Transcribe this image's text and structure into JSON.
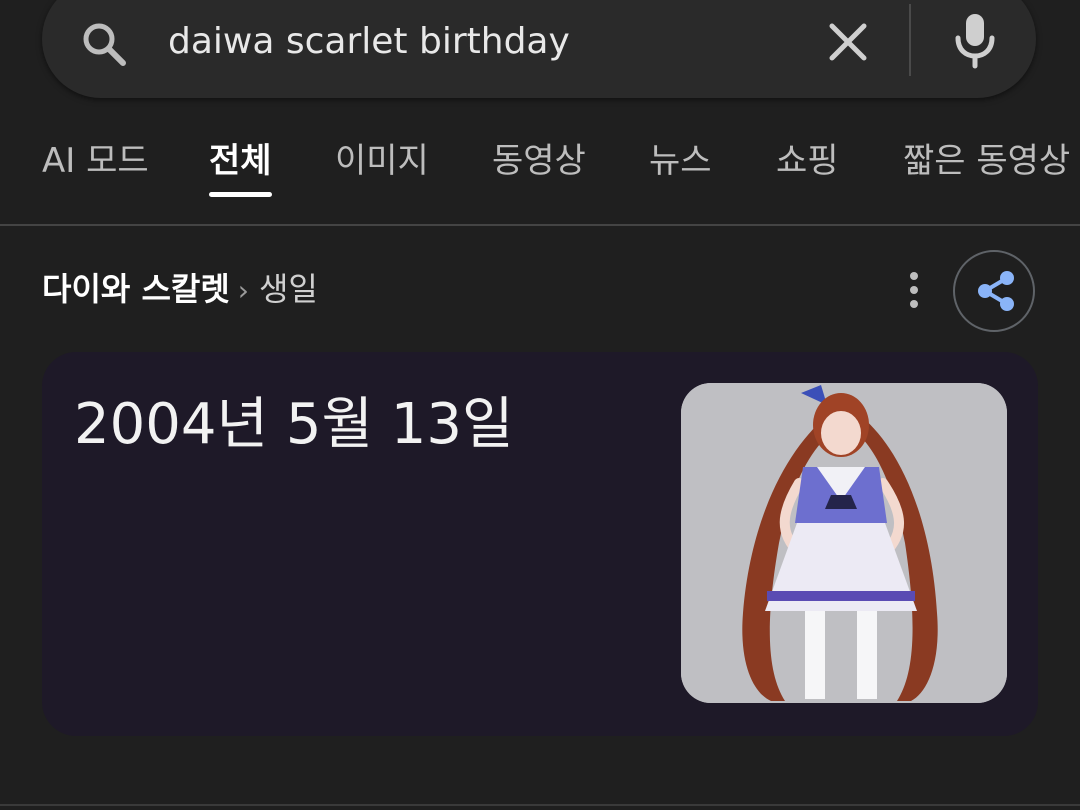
{
  "search": {
    "query": "daiwa scarlet birthday"
  },
  "tabs": [
    {
      "label": "AI 모드"
    },
    {
      "label": "전체",
      "active": true
    },
    {
      "label": "이미지"
    },
    {
      "label": "동영상"
    },
    {
      "label": "뉴스"
    },
    {
      "label": "쇼핑"
    },
    {
      "label": "짧은 동영상"
    }
  ],
  "breadcrumb": {
    "entity": "다이와 스칼렛",
    "separator": "›",
    "attribute": "생일"
  },
  "answer": {
    "value": "2004년 5월 13일"
  },
  "icons": {
    "search": "search-icon",
    "clear": "close-icon",
    "mic": "microphone-icon",
    "more": "more-vert-icon",
    "share": "share-icon"
  },
  "colors": {
    "background": "#1f1f1f",
    "card": "#1e1928",
    "accent": "#8ab4f8"
  }
}
